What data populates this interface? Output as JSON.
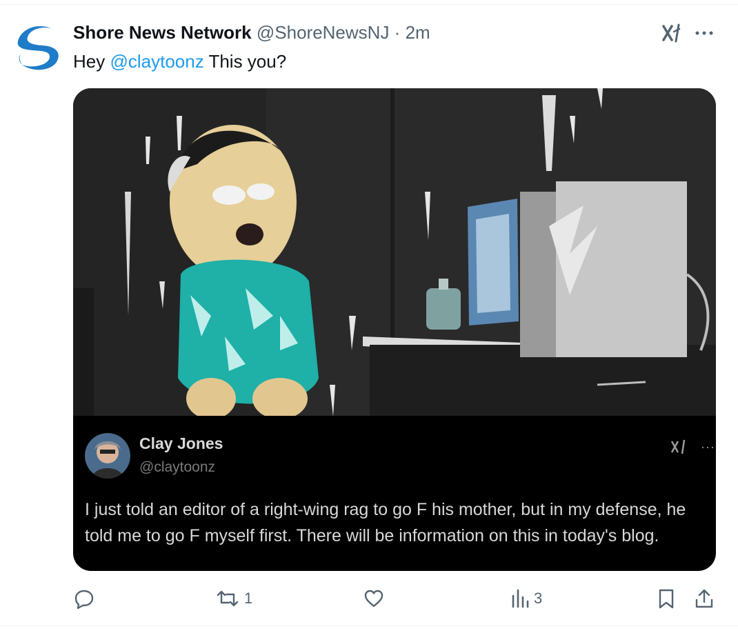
{
  "tweet": {
    "display_name": "Shore News Network",
    "handle": "@ShoreNewsNJ",
    "separator": "·",
    "time": "2m",
    "text_before": "Hey ",
    "mention": "@claytoonz",
    "text_after": " This you?"
  },
  "quoted_post": {
    "name": "Clay Jones",
    "handle": "@claytoonz",
    "more": "···",
    "text": "I just told an editor of a right-wing rag to go F his mother, but in my defense, he told me to go F myself first. There will be information on this in today's blog."
  },
  "actions": {
    "reply_count": "",
    "repost_count": "1",
    "like_count": "",
    "views_count": "3"
  },
  "icons": {
    "avatar": "shore-news-logo",
    "grok": "grok-icon",
    "more": "more-icon",
    "reply": "reply-icon",
    "repost": "repost-icon",
    "like": "heart-icon",
    "views": "views-icon",
    "bookmark": "bookmark-icon",
    "share": "share-icon"
  },
  "colors": {
    "link": "#1d9bf0",
    "secondary": "#536471",
    "logo_blue": "#1e7cc8"
  }
}
